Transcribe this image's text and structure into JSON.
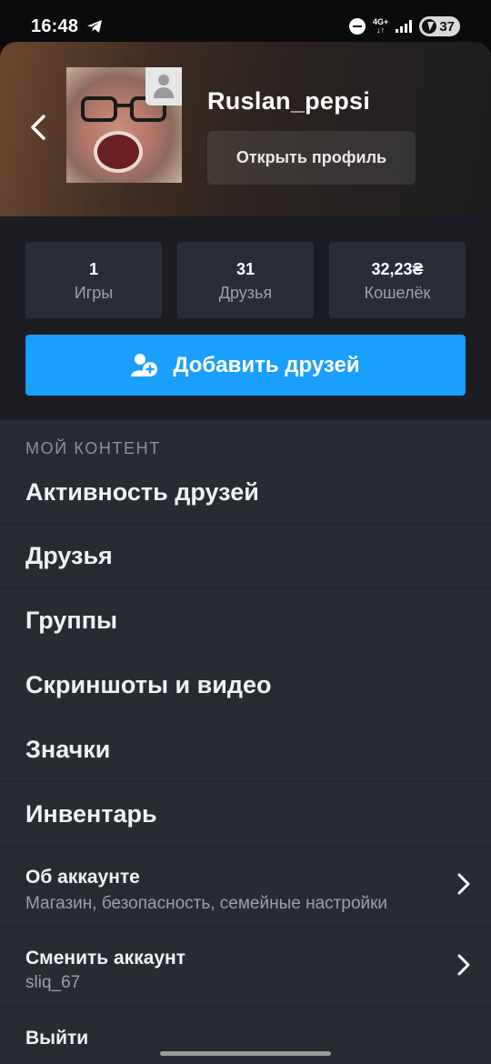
{
  "status_bar": {
    "time": "16:48",
    "network_top": "4G+",
    "network_bottom": "↓↑",
    "battery": "37",
    "icons": [
      "telegram-icon",
      "do-not-disturb-icon",
      "signal-icon",
      "battery-icon"
    ]
  },
  "header": {
    "username": "Ruslan_pepsi",
    "open_profile_label": "Открыть профиль"
  },
  "stats": [
    {
      "value": "1",
      "label": "Игры"
    },
    {
      "value": "31",
      "label": "Друзья"
    },
    {
      "value": "32,23₴",
      "label": "Кошелёк"
    }
  ],
  "add_friends_label": "Добавить друзей",
  "content": {
    "section_title": "МОЙ КОНТЕНТ",
    "items": [
      {
        "label": "Активность друзей"
      },
      {
        "label": "Друзья"
      },
      {
        "label": "Группы"
      },
      {
        "label": "Скриншоты и видео"
      },
      {
        "label": "Значки"
      },
      {
        "label": "Инвентарь"
      }
    ],
    "account": {
      "title": "Об аккаунте",
      "subtitle": "Магазин, безопасность, семейные настройки"
    },
    "switch_account": {
      "title": "Сменить аккаунт",
      "subtitle": "sliq_67"
    },
    "logout": {
      "title": "Выйти"
    }
  },
  "colors": {
    "accent": "#1a9fff",
    "background": "#1b1d23",
    "list_background": "#292b33",
    "tile": "#2a2d36"
  }
}
